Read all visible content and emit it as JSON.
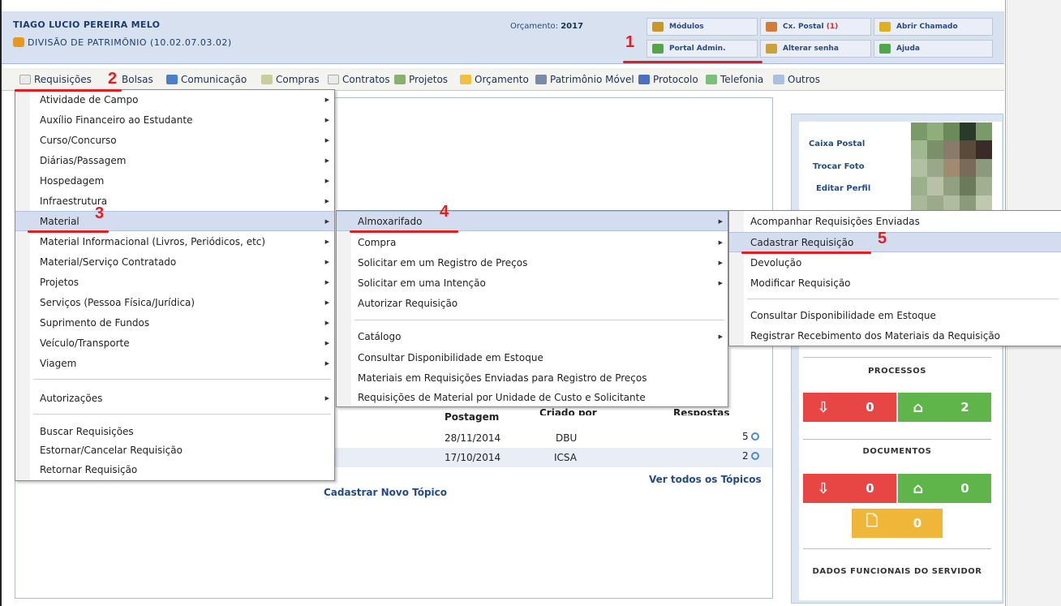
{
  "header": {
    "user_name": "TIAGO LUCIO PEREIRA MELO",
    "unit": "DIVISÃO DE PATRIMÔNIO (10.02.07.03.02)",
    "budget_label": "Orçamento:",
    "budget_year": "2017",
    "buttons": {
      "modulos": "Módulos",
      "cx_postal": "Cx. Postal",
      "cx_postal_count": "(1)",
      "abrir_chamado": "Abrir Chamado",
      "portal_admin": "Portal Admin.",
      "alterar_senha": "Alterar senha",
      "ajuda": "Ajuda"
    }
  },
  "menubar": [
    "Requisições",
    "Bolsas",
    "Comunicação",
    "Compras",
    "Contratos",
    "Projetos",
    "Orçamento",
    "Patrimônio Móvel",
    "Protocolo",
    "Telefonia",
    "Outros"
  ],
  "menu_requisicoes": [
    "Atividade de Campo",
    "Auxílio Financeiro ao Estudante",
    "Curso/Concurso",
    "Diárias/Passagem",
    "Hospedagem",
    "Infraestrutura",
    "Material",
    "Material Informacional (Livros, Periódicos, etc)",
    "Material/Serviço Contratado",
    "Projetos",
    "Serviços (Pessoa Física/Jurídica)",
    "Suprimento de Fundos",
    "Veículo/Transporte",
    "Viagem",
    "Autorizações",
    "Buscar Requisições",
    "Estornar/Cancelar Requisição",
    "Retornar Requisição"
  ],
  "menu_material": [
    "Almoxarifado",
    "Compra",
    "Solicitar em um Registro de Preços",
    "Solicitar em uma Intenção",
    "Autorizar Requisição",
    "Catálogo",
    "Consultar Disponibilidade em Estoque",
    "Materiais em Requisições Enviadas para Registro de Preços",
    "Requisições de Material por Unidade de Custo e Solicitante"
  ],
  "menu_almoxarifado": [
    "Acompanhar Requisições Enviadas",
    "Cadastrar Requisição",
    "Devolução",
    "Modificar Requisição",
    "Consultar Disponibilidade em Estoque",
    "Registrar Recebimento dos Materiais da Requisição"
  ],
  "forum": {
    "col_postagem": "Postagem",
    "col_criado_por": "Criado por",
    "col_respostas": "Respostas",
    "rows": [
      {
        "date": "28/11/2014",
        "author": "DBU",
        "replies": "5"
      },
      {
        "date": "17/10/2014",
        "author": "ICSA",
        "replies": "2"
      }
    ],
    "ver_todos": "Ver todos os Tópicos",
    "novo_topico": "Cadastrar Novo Tópico"
  },
  "profile": {
    "links": [
      "Caixa Postal",
      "Trocar Foto",
      "Editar Perfil"
    ],
    "processos_title": "PROCESSOS",
    "processos": {
      "inbox": "0",
      "home": "2"
    },
    "documentos_title": "DOCUMENTOS",
    "documentos": {
      "inbox": "0",
      "home": "0",
      "pending": "0"
    },
    "dados_title": "DADOS FUNCIONAIS DO SERVIDOR"
  },
  "annotations": [
    "1",
    "2",
    "3",
    "4",
    "5"
  ],
  "colors": {
    "header_bg": "#d7e1f0",
    "menu_highlight": "#d4ddf0",
    "stat_red": "#e84545",
    "stat_green": "#5fb54a",
    "stat_yellow": "#f0b63a",
    "annotation_red": "#e02020"
  }
}
